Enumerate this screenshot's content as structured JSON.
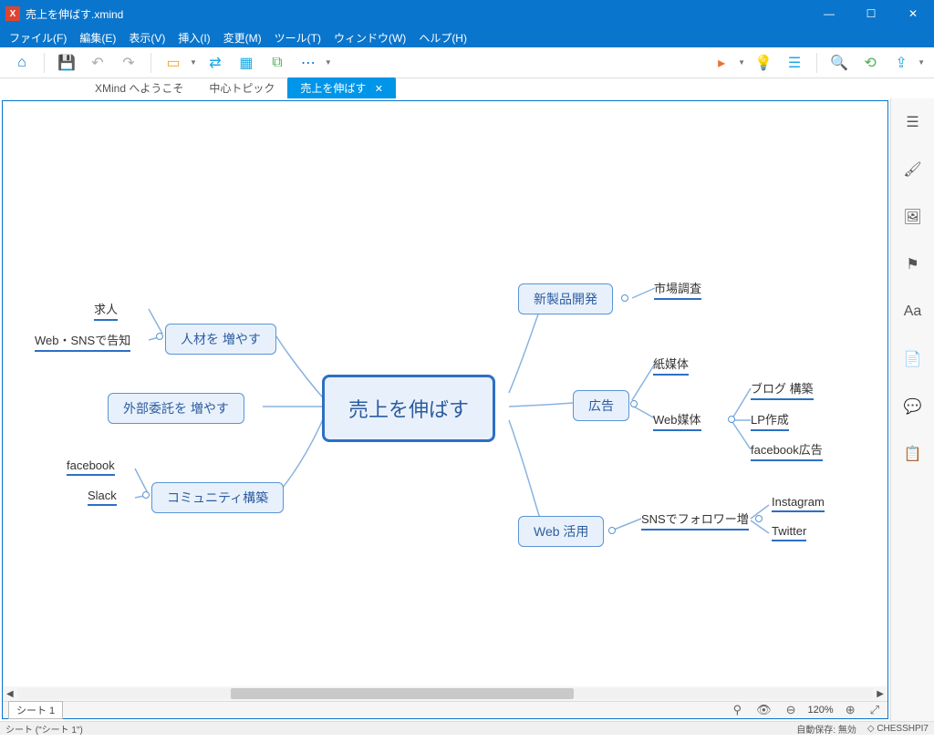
{
  "window": {
    "title": "売上を伸ばす.xmind",
    "min": "—",
    "max": "☐",
    "close": "✕"
  },
  "menus": [
    "ファイル(F)",
    "編集(E)",
    "表示(V)",
    "挿入(I)",
    "変更(M)",
    "ツール(T)",
    "ウィンドウ(W)",
    "ヘルプ(H)"
  ],
  "tabs": [
    {
      "label": "XMind へようこそ",
      "active": false
    },
    {
      "label": "中心トピック",
      "active": false
    },
    {
      "label": "売上を伸ばす",
      "active": true
    }
  ],
  "mindmap": {
    "central": "売上を伸ばす",
    "left": {
      "n1": "人材を 増やす",
      "n1_leaves": [
        "求人",
        "Web・SNSで告知"
      ],
      "n2": "外部委託を 増やす",
      "n3": "コミュニティ構築",
      "n3_leaves": [
        "facebook",
        "Slack"
      ]
    },
    "right": {
      "r1": "新製品開発",
      "r1_leaves": [
        "市場調査"
      ],
      "r2": "広告",
      "r2_leaves": [
        "紙媒体",
        "Web媒体"
      ],
      "r2_web_leaves": [
        "ブログ 構築",
        "LP作成",
        "facebook広告"
      ],
      "r3": "Web 活用",
      "r3_leaf": "SNSでフォロワー増",
      "r3_sub": [
        "Instagram",
        "Twitter"
      ]
    }
  },
  "bottom": {
    "sheet": "シート 1",
    "zoom": "120%"
  },
  "status": {
    "left": "シート (\"シート 1\")",
    "autosave": "自動保存: 無効",
    "machine": "◇ CHESSHPI7"
  }
}
